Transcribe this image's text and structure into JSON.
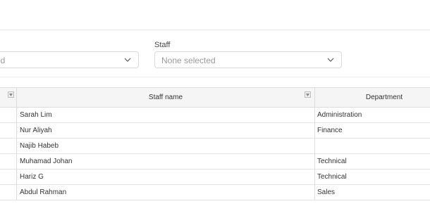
{
  "filters": {
    "left_select": {
      "value": "ed"
    },
    "staff": {
      "label": "Staff",
      "value": "None selected"
    }
  },
  "table": {
    "columns": [
      {
        "label": "Staff name"
      },
      {
        "label": "Department"
      }
    ],
    "rows": [
      {
        "staff_name": "Sarah Lim",
        "department": "Administration"
      },
      {
        "staff_name": "Nur Aliyah",
        "department": "Finance"
      },
      {
        "staff_name": "Najib Habeb",
        "department": ""
      },
      {
        "staff_name": "Muhamad Johan",
        "department": "Technical"
      },
      {
        "staff_name": "Hariz G",
        "department": "Technical"
      },
      {
        "staff_name": "Abdul Rahman",
        "department": "Sales"
      }
    ]
  },
  "icons": {
    "select_chevron": "chevron-down-icon",
    "column_filter": "filter-dropdown-icon"
  }
}
